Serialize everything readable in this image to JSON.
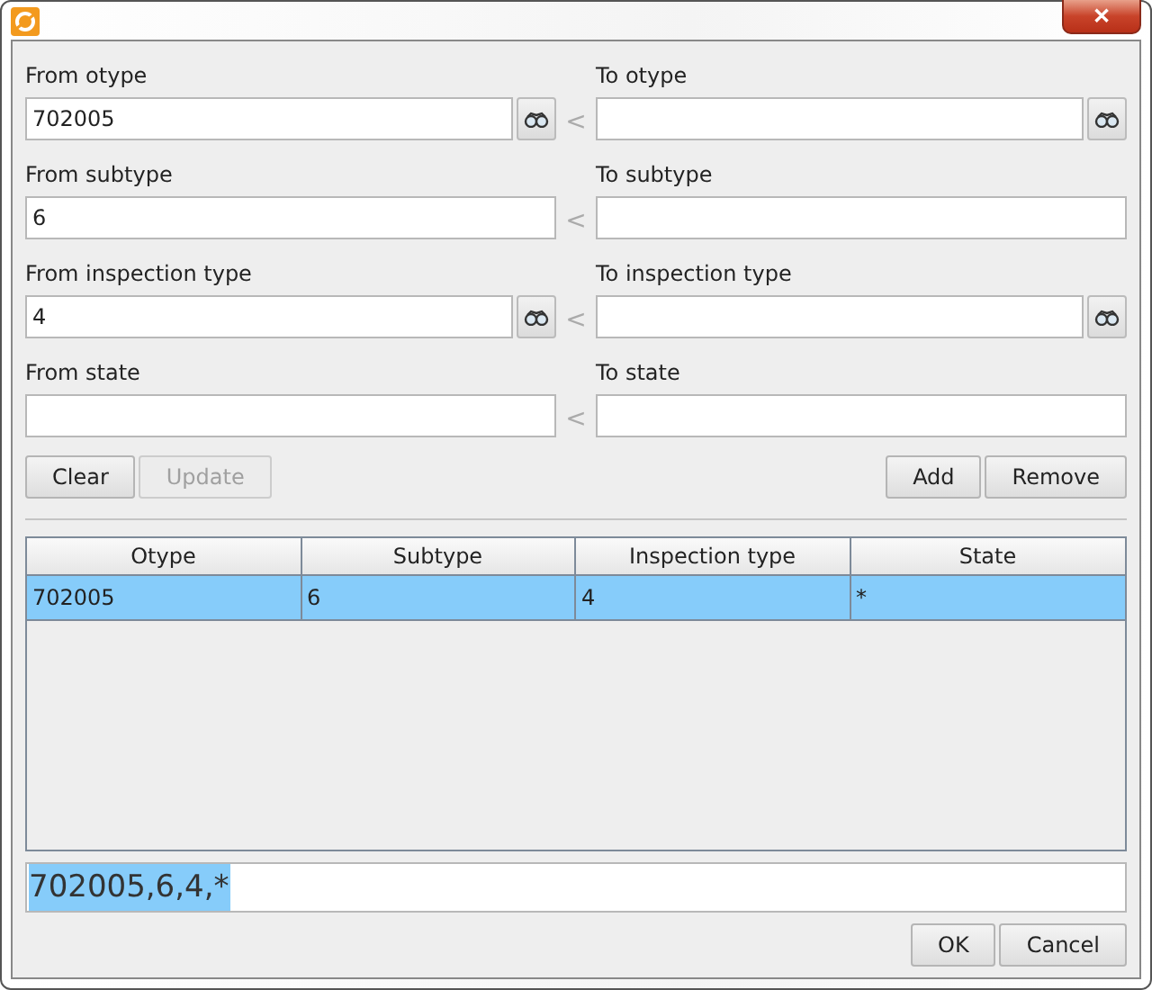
{
  "window": {
    "close": "✕"
  },
  "filters": [
    {
      "from_label": "From otype",
      "from_value": "702005",
      "to_label": "To otype",
      "separator": "<",
      "lookup": true
    },
    {
      "from_label": "From subtype",
      "from_value": "6",
      "to_label": "To subtype",
      "separator": "<",
      "lookup": false
    },
    {
      "from_label": "From inspection type",
      "from_value": "4",
      "to_label": "To inspection type",
      "separator": "<",
      "lookup": true
    },
    {
      "from_label": "From state",
      "to_label": "To state",
      "separator": "<",
      "lookup": false
    }
  ],
  "left_buttons": [
    {
      "label": "Clear",
      "disabled": false
    },
    {
      "label": "Update",
      "disabled": true
    }
  ],
  "right_buttons": [
    {
      "label": "Add",
      "disabled": false
    },
    {
      "label": "Remove",
      "disabled": false
    }
  ],
  "table": {
    "columns": [
      "Otype",
      "Subtype",
      "Inspection type",
      "State"
    ],
    "rows": [
      {
        "cells": [
          "702005",
          "6",
          "4",
          "*"
        ],
        "selected": true
      }
    ]
  },
  "result": {
    "value": "702005,6,4,*",
    "selected": true
  },
  "footer_buttons": [
    {
      "label": "OK",
      "disabled": false
    },
    {
      "label": "Cancel",
      "disabled": false
    }
  ]
}
